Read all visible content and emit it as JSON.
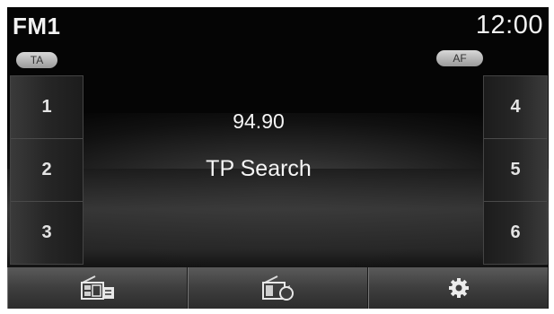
{
  "header": {
    "band_label": "FM1",
    "clock": "12:00"
  },
  "toggles": {
    "ta_label": "TA",
    "af_label": "AF"
  },
  "presets": {
    "left": [
      "1",
      "2",
      "3"
    ],
    "right": [
      "4",
      "5",
      "6"
    ]
  },
  "main": {
    "frequency": "94.90",
    "status": "TP Search"
  },
  "bottom_bar": {
    "icons": [
      "radio-list-icon",
      "radio-scan-icon",
      "gear-icon"
    ]
  },
  "colors": {
    "screen_bg": "#050505",
    "text": "#f2f2f2",
    "button_bg": "#3e3e3e"
  }
}
